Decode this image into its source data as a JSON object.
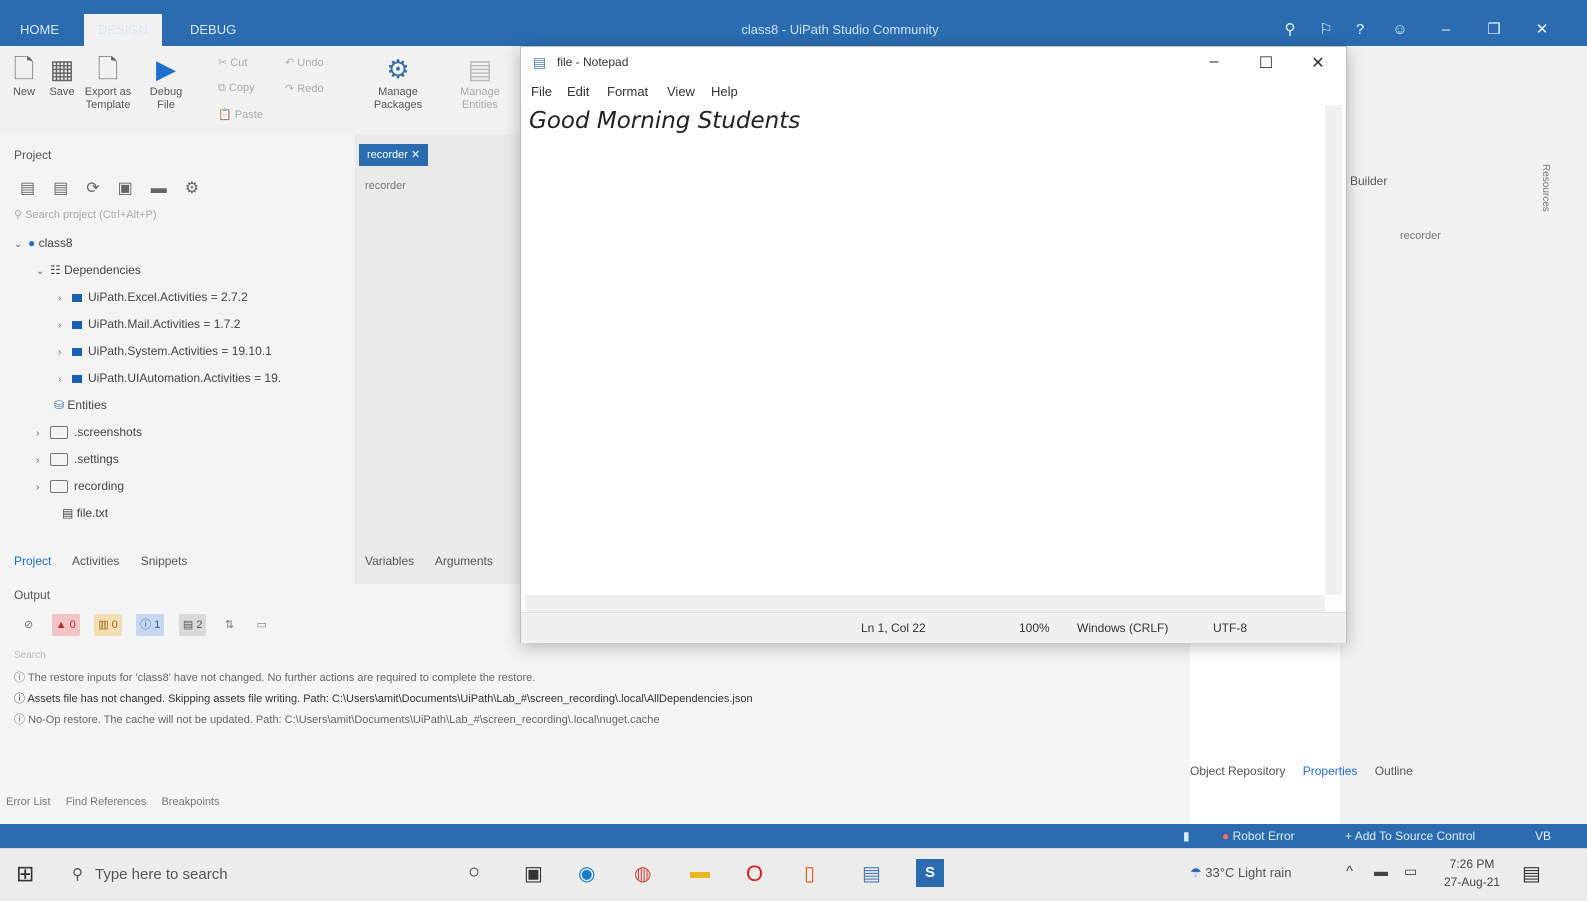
{
  "studio": {
    "tabs": [
      "HOME",
      "DESIGN",
      "DEBUG"
    ],
    "title": "class8 - UiPath Studio Community",
    "ribbon": {
      "new": "New",
      "save": "Save",
      "export": "Export as Template",
      "debug": "Debug File",
      "cut": "Cut",
      "copy": "Copy",
      "paste": "Paste",
      "undo": "Undo",
      "redo": "Redo",
      "manage_packages": "Manage Packages",
      "manage_entities": "Manage Entities"
    },
    "project_panel": {
      "title": "Project",
      "search_placeholder": "Search project (Ctrl+Alt+P)",
      "tree": {
        "root": "class8",
        "dependencies": "Dependencies",
        "packages": [
          "UiPath.Excel.Activities = 2.7.2",
          "UiPath.Mail.Activities = 1.7.2",
          "UiPath.System.Activities = 19.10.1",
          "UiPath.UIAutomation.Activities = 19."
        ],
        "entities": "Entities",
        "folders": [
          ".screenshots",
          ".settings",
          "recording"
        ],
        "file": "file.txt"
      },
      "bottom_tabs": [
        "Project",
        "Activities",
        "Snippets"
      ]
    },
    "designer": {
      "tab": "recorder",
      "breadcrumb": "recorder",
      "bottom_tabs": [
        "Variables",
        "Arguments"
      ]
    },
    "right_panel": {
      "title": "Builder",
      "item": "recorder",
      "side_tab": "Resources",
      "bottom_tabs": [
        "Object Repository",
        "Properties",
        "Outline"
      ]
    },
    "output": {
      "title": "Output",
      "search_placeholder": "Search",
      "counts": {
        "errors": "0",
        "warnings": "0",
        "info": "1",
        "trace": "2"
      },
      "lines": [
        "The restore inputs for 'class8' have not changed. No further actions are required to complete the restore.",
        "Assets file has not changed. Skipping assets file writing. Path: C:\\Users\\amit\\Documents\\UiPath\\Lab_#\\screen_recording\\.local\\AllDependencies.json",
        "No-Op restore. The cache will not be updated. Path: C:\\Users\\amit\\Documents\\UiPath\\Lab_#\\screen_recording\\.local\\nuget.cache"
      ]
    },
    "bottom_links": [
      "Error List",
      "Find References",
      "Breakpoints"
    ],
    "statusbar": {
      "robot": "Robot Error",
      "source_control": "Add To Source Control",
      "version": "VB"
    }
  },
  "notepad": {
    "title": "file - Notepad",
    "menu": [
      "File",
      "Edit",
      "Format",
      "View",
      "Help"
    ],
    "content": "Good Morning Students",
    "status": {
      "position": "Ln 1, Col 22",
      "zoom": "100%",
      "line_ending": "Windows (CRLF)",
      "encoding": "UTF-8"
    }
  },
  "taskbar": {
    "search_placeholder": "Type here to search",
    "weather": "33°C  Light rain",
    "time": "7:26 PM",
    "date": "27-Aug-21"
  },
  "colors": {
    "studio_blue": "#2b6cb0",
    "ribbon_bg": "#f1f1f1",
    "notepad_bg": "#ffffff"
  }
}
